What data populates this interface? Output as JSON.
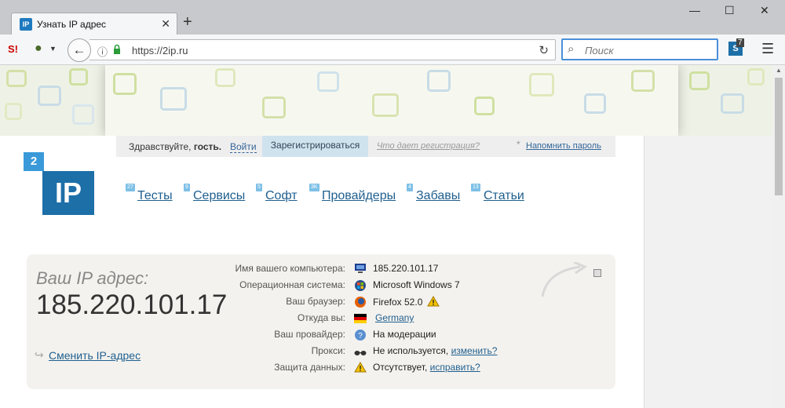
{
  "browser": {
    "tab_title": "Узнать IP адрес",
    "tab_favicon": "IP",
    "url": "https://2ip.ru",
    "search_placeholder": "Поиск",
    "ext_badge": "7",
    "extension_icons": [
      "s-icon",
      "onion-icon"
    ]
  },
  "login": {
    "greeting_prefix": "Здравствуйте, ",
    "greeting_name": "гость.",
    "login_link": "Войти",
    "register_button": "Зарегистрироваться",
    "why_register": "Что дает регистрация?",
    "remind_password": "Напомнить пароль",
    "asterisk": "*"
  },
  "logo": {
    "small": "2",
    "big": "IP"
  },
  "menu": [
    {
      "label": "Тесты",
      "badge": "27"
    },
    {
      "label": "Сервисы",
      "badge": "9"
    },
    {
      "label": "Софт",
      "badge": "5"
    },
    {
      "label": "Провайдеры",
      "badge": "3K"
    },
    {
      "label": "Забавы",
      "badge": "4"
    },
    {
      "label": "Статьи",
      "badge": "13"
    }
  ],
  "ip": {
    "caption": "Ваш IP адрес:",
    "value": "185.220.101.17",
    "change_link": "Сменить IP-адрес"
  },
  "info": [
    {
      "label": "Имя вашего компьютера:",
      "value": "185.220.101.17",
      "icon": "computer-icon"
    },
    {
      "label": "Операционная система:",
      "value": "Microsoft Windows 7",
      "icon": "windows-icon"
    },
    {
      "label": "Ваш браузер:",
      "value": "Firefox 52.0",
      "icon": "firefox-icon"
    },
    {
      "label": "Откуда вы:",
      "value": "Germany",
      "icon": "germany-flag-icon"
    },
    {
      "label": "Ваш провайдер:",
      "value": "На модерации",
      "icon": "help-icon"
    },
    {
      "label": "Прокси:",
      "value": "Не используется,",
      "link": "изменить?",
      "icon": "glasses-icon"
    },
    {
      "label": "Защита данных:",
      "value": "Отсутствует,",
      "link": "исправить?",
      "icon": "warning-icon"
    }
  ],
  "colors": {
    "accent": "#1d6fa8",
    "link": "#1f5f8f",
    "box_bg": "#f4f2ee"
  }
}
